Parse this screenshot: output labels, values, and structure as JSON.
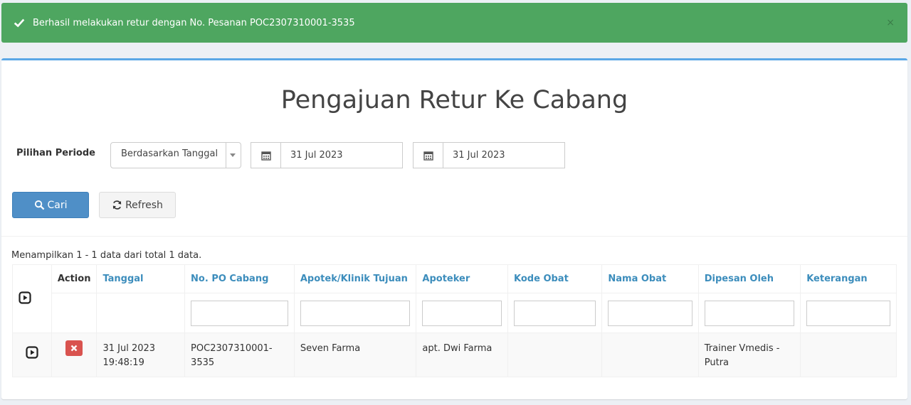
{
  "alert": {
    "message": "Berhasil melakukan retur dengan No. Pesanan POC2307310001-3535",
    "close": "×"
  },
  "title": "Pengajuan Retur Ke Cabang",
  "filters": {
    "period_label": "Pilihan Periode",
    "period_select": "Berdasarkan Tanggal",
    "date_from": "31 Jul 2023",
    "date_to": "31 Jul 2023"
  },
  "buttons": {
    "search": "Cari",
    "refresh": "Refresh"
  },
  "summary": "Menampilkan 1 - 1 data dari total 1 data.",
  "table": {
    "columns": [
      "Action",
      "Tanggal",
      "No. PO Cabang",
      "Apotek/Klinik Tujuan",
      "Apoteker",
      "Kode Obat",
      "Nama Obat",
      "Dipesan Oleh",
      "Keterangan"
    ],
    "rows": [
      {
        "tanggal": "31 Jul 2023 19:48:19",
        "no_po": "POC2307310001-3535",
        "apotek": "Seven Farma",
        "apoteker": "apt. Dwi Farma",
        "kode_obat": "",
        "nama_obat": "",
        "dipesan_oleh": "Trainer Vmedis - Putra",
        "keterangan": ""
      }
    ]
  },
  "colors": {
    "alert_bg": "#4ea660",
    "primary": "#4f8fc7",
    "link": "#3c8dbc",
    "danger": "#d9534f",
    "box_top": "#5aa7e6"
  }
}
